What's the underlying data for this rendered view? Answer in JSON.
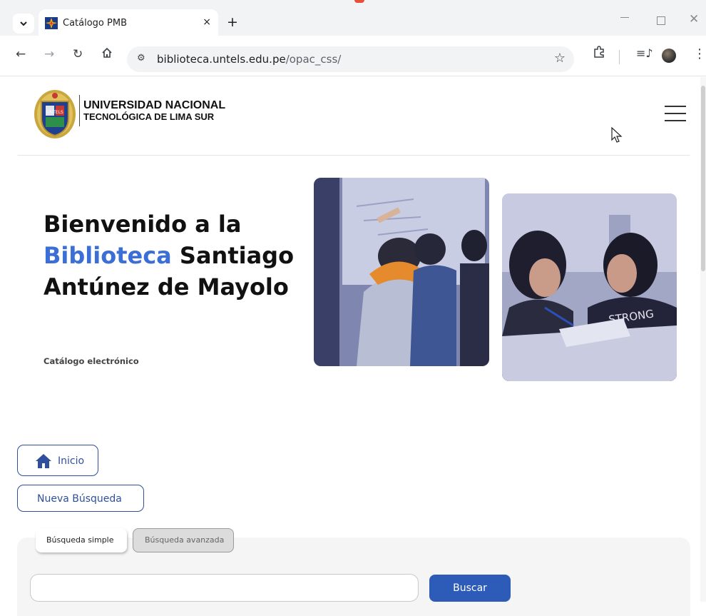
{
  "browser": {
    "tab_title": "Catálogo PMB",
    "tab_close": "×",
    "new_tab": "+",
    "url_domain": "biblioteca.untels.edu.pe",
    "url_path": "/opac_css/",
    "icons": [
      "chevron-down-icon",
      "favicon-icon",
      "back-icon",
      "forward-icon",
      "reload-icon",
      "home-icon",
      "site-info-icon",
      "star-icon",
      "extensions-icon",
      "media-icon",
      "profile-icon",
      "menu-icon"
    ]
  },
  "header": {
    "university_line1": "UNIVERSIDAD NACIONAL",
    "university_line2": "TECNOLÓGICA DE LIMA SUR",
    "logo_text": "UNTELS"
  },
  "hero": {
    "title_part1": "Bienvenido a la",
    "title_highlight": "Biblioteca",
    "title_part2": " Santiago Antúnez de Mayolo",
    "subtitle": "Catálogo electrónico",
    "accent_color": "#3b6fd6"
  },
  "nav": {
    "home_label": "Inicio",
    "new_search_label": "Nueva Búsqueda",
    "button_color": "#2f4f9e"
  },
  "search": {
    "tab_simple": "Búsqueda simple",
    "tab_advanced": "Búsqueda avanzada",
    "query": "",
    "button_label": "Buscar",
    "button_color": "#2c5bb8"
  }
}
